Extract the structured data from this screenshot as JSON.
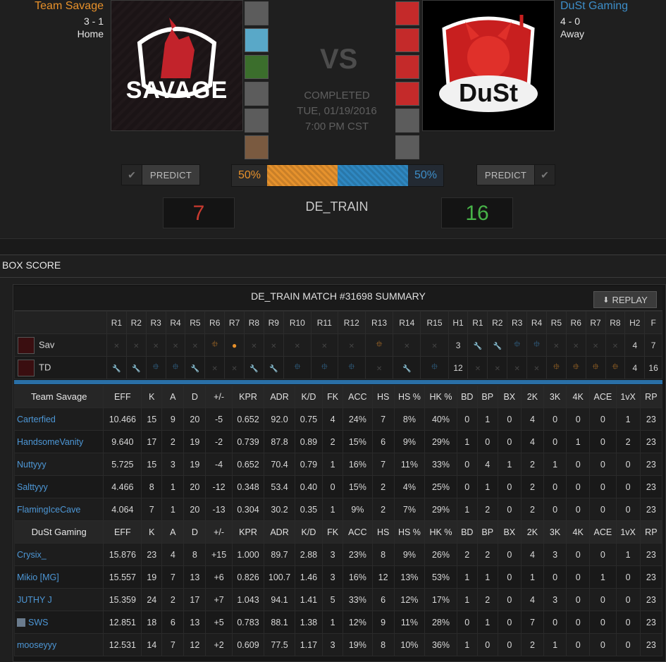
{
  "home": {
    "name": "Team Savage",
    "record": "3 - 1",
    "side": "Home",
    "logo_text": "SAVAGE",
    "score": "7",
    "predict_label": "PREDICT",
    "percent": "50%"
  },
  "away": {
    "name": "DuSt Gaming",
    "record": "4 - 0",
    "side": "Away",
    "logo_text": "DuSt",
    "score": "16",
    "predict_label": "PREDICT",
    "percent": "50%"
  },
  "match": {
    "vs": "VS",
    "status": "COMPLETED",
    "date": "TUE, 01/19/2016",
    "time": "7:00 PM CST",
    "map": "DE_TRAIN",
    "prediction_home_fraction": 0.5
  },
  "box_score": {
    "title": "BOX SCORE",
    "summary_title": "DE_TRAIN MATCH #31698 SUMMARY",
    "replay_label": "REPLAY"
  },
  "rounds": {
    "headers": [
      "R1",
      "R2",
      "R3",
      "R4",
      "R5",
      "R6",
      "R7",
      "R8",
      "R9",
      "R10",
      "R11",
      "R12",
      "R13",
      "R14",
      "R15",
      "H1",
      "R1",
      "R2",
      "R3",
      "R4",
      "R5",
      "R6",
      "R7",
      "R8",
      "H2",
      "F"
    ],
    "teams": [
      {
        "abbr": "Sav",
        "cells": [
          "x",
          "x",
          "x",
          "x",
          "x",
          "diamond-o",
          "bomb-o",
          "x",
          "x",
          "x",
          "x",
          "x",
          "diamond-o",
          "x",
          "x",
          "3",
          "wrench",
          "wrench",
          "diamond",
          "diamond",
          "x",
          "x",
          "x",
          "x",
          "4",
          "7"
        ]
      },
      {
        "abbr": "TD",
        "cells": [
          "wrench",
          "wrench",
          "diamond",
          "diamond",
          "wrench",
          "x",
          "x",
          "wrench",
          "wrench",
          "diamond",
          "diamond",
          "diamond",
          "x",
          "wrench",
          "diamond",
          "12",
          "x",
          "x",
          "x",
          "x",
          "diamond-o",
          "diamond-o",
          "diamond-o",
          "diamond-o",
          "4",
          "16"
        ]
      }
    ]
  },
  "stats": {
    "columns": [
      "EFF",
      "K",
      "A",
      "D",
      "+/-",
      "KPR",
      "ADR",
      "K/D",
      "FK",
      "ACC",
      "HS",
      "HS %",
      "HK %",
      "BD",
      "BP",
      "BX",
      "2K",
      "3K",
      "4K",
      "ACE",
      "1vX",
      "RP"
    ],
    "home_label": "Team Savage",
    "away_label": "DuSt Gaming",
    "home_players": [
      [
        "Carterfied",
        "10.466",
        "15",
        "9",
        "20",
        "-5",
        "0.652",
        "92.0",
        "0.75",
        "4",
        "24%",
        "7",
        "8%",
        "40%",
        "0",
        "1",
        "0",
        "4",
        "0",
        "0",
        "0",
        "1",
        "23"
      ],
      [
        "HandsomeVanity",
        "9.640",
        "17",
        "2",
        "19",
        "-2",
        "0.739",
        "87.8",
        "0.89",
        "2",
        "15%",
        "6",
        "9%",
        "29%",
        "1",
        "0",
        "0",
        "4",
        "0",
        "1",
        "0",
        "2",
        "23"
      ],
      [
        "Nuttyyy",
        "5.725",
        "15",
        "3",
        "19",
        "-4",
        "0.652",
        "70.4",
        "0.79",
        "1",
        "16%",
        "7",
        "11%",
        "33%",
        "0",
        "4",
        "1",
        "2",
        "1",
        "0",
        "0",
        "0",
        "23"
      ],
      [
        "Salttyyy",
        "4.466",
        "8",
        "1",
        "20",
        "-12",
        "0.348",
        "53.4",
        "0.40",
        "0",
        "15%",
        "2",
        "4%",
        "25%",
        "0",
        "1",
        "0",
        "2",
        "0",
        "0",
        "0",
        "0",
        "23"
      ],
      [
        "FlamingIceCave",
        "4.064",
        "7",
        "1",
        "20",
        "-13",
        "0.304",
        "30.2",
        "0.35",
        "1",
        "9%",
        "2",
        "7%",
        "29%",
        "1",
        "2",
        "0",
        "2",
        "0",
        "0",
        "0",
        "0",
        "23"
      ]
    ],
    "away_players": [
      [
        "Crysix_",
        "15.876",
        "23",
        "4",
        "8",
        "+15",
        "1.000",
        "89.7",
        "2.88",
        "3",
        "23%",
        "8",
        "9%",
        "26%",
        "2",
        "2",
        "0",
        "4",
        "3",
        "0",
        "0",
        "1",
        "23"
      ],
      [
        "Mikio [MG]",
        "15.557",
        "19",
        "7",
        "13",
        "+6",
        "0.826",
        "100.7",
        "1.46",
        "3",
        "16%",
        "12",
        "13%",
        "53%",
        "1",
        "1",
        "0",
        "1",
        "0",
        "0",
        "1",
        "0",
        "23"
      ],
      [
        "JUTHY J",
        "15.359",
        "24",
        "2",
        "17",
        "+7",
        "1.043",
        "94.1",
        "1.41",
        "5",
        "33%",
        "6",
        "12%",
        "17%",
        "1",
        "2",
        "0",
        "4",
        "3",
        "0",
        "0",
        "0",
        "23"
      ],
      [
        "SWS",
        "12.851",
        "18",
        "6",
        "13",
        "+5",
        "0.783",
        "88.1",
        "1.38",
        "1",
        "12%",
        "9",
        "11%",
        "28%",
        "0",
        "1",
        "0",
        "7",
        "0",
        "0",
        "0",
        "0",
        "23"
      ],
      [
        "mooseyyy",
        "12.531",
        "14",
        "7",
        "12",
        "+2",
        "0.609",
        "77.5",
        "1.17",
        "3",
        "19%",
        "8",
        "10%",
        "36%",
        "1",
        "0",
        "0",
        "2",
        "1",
        "0",
        "0",
        "0",
        "23"
      ]
    ]
  },
  "colors": {
    "home_accent": "#e8912a",
    "away_accent": "#3d8ec9",
    "home_score": "#c93a2f",
    "away_score": "#47b348"
  }
}
